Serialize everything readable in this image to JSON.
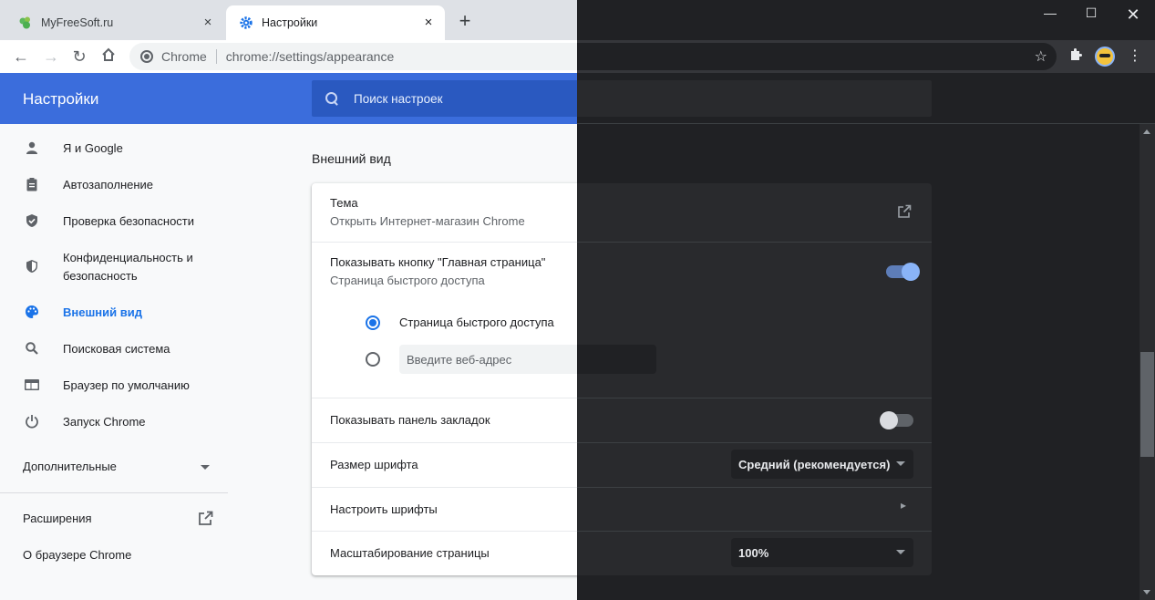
{
  "tabs": [
    {
      "title": "MyFreeSoft.ru"
    },
    {
      "title": "Настройки"
    }
  ],
  "toolbar": {
    "site_name": "Chrome",
    "url": "chrome://settings/appearance"
  },
  "header": {
    "title": "Настройки",
    "search_placeholder": "Поиск настроек"
  },
  "sidebar": {
    "items": [
      {
        "label": "Я и Google",
        "icon": "person-icon"
      },
      {
        "label": "Автозаполнение",
        "icon": "clipboard-icon"
      },
      {
        "label": "Проверка безопасности",
        "icon": "shield-check-icon"
      },
      {
        "label": "Конфиденциальность и безопасность",
        "icon": "shield-half-icon"
      },
      {
        "label": "Внешний вид",
        "icon": "palette-icon",
        "active": true
      },
      {
        "label": "Поисковая система",
        "icon": "search-icon"
      },
      {
        "label": "Браузер по умолчанию",
        "icon": "browser-window-icon"
      },
      {
        "label": "Запуск Chrome",
        "icon": "power-icon"
      }
    ],
    "advanced": "Дополнительные",
    "extensions": "Расширения",
    "about": "О браузере Chrome"
  },
  "appearance": {
    "section_title": "Внешний вид",
    "theme_label": "Тема",
    "theme_sub": "Открыть Интернет-магазин Chrome",
    "home_button_label": "Показывать кнопку \"Главная страница\"",
    "home_button_sub": "Страница быстрого доступа",
    "home_button_on": true,
    "radio_ntp": "Страница быстрого доступа",
    "radio_url_placeholder": "Введите веб-адрес",
    "bookmarks_bar_label": "Показывать панель закладок",
    "bookmarks_bar_on": false,
    "font_size_label": "Размер шрифта",
    "font_size_value": "Средний (рекомендуется)",
    "customize_fonts_label": "Настроить шрифты",
    "page_zoom_label": "Масштабирование страницы",
    "page_zoom_value": "100%"
  },
  "colors": {
    "light_header": "#3b6ddc",
    "light_bg": "#f8f9fa",
    "dark_bg": "#202124",
    "accent": "#1a73e8",
    "dark_accent": "#8ab4f8"
  }
}
